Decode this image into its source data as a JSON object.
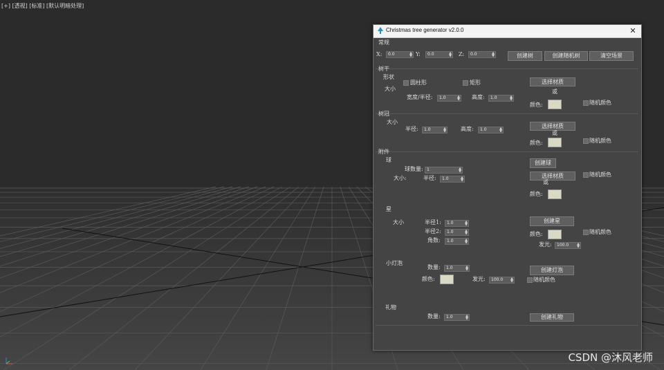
{
  "viewport": {
    "label": "[+] [透视] [标准] [默认明暗处理]",
    "watermark": "CSDN @沐风老师"
  },
  "dialog": {
    "title": "Christmas tree generator v2.0.0",
    "icon": "tree-app-icon",
    "close_icon": "✕"
  },
  "general": {
    "section": "常规",
    "x_label": "X:",
    "x_value": "0.0",
    "y_label": "Y:",
    "y_value": "0.0",
    "z_label": "Z:",
    "z_value": "0.0",
    "create_tree": "创建树",
    "create_random_tree": "创建随机树",
    "clear_scene": "清空场景"
  },
  "trunk": {
    "section": "树干",
    "shape_label": "形状",
    "cylinder": "圆柱形",
    "rectangle": "矩形",
    "size_label": "大小",
    "width_radius_label": "宽度/半径:",
    "width_radius_value": "1.0",
    "height_label": "高度:",
    "height_value": "1.0",
    "select_material": "选择材质",
    "or": "或",
    "color_label": "颜色:",
    "random_color": "随机颜色"
  },
  "crown": {
    "section": "树冠",
    "size_label": "大小",
    "radius_label": "半径:",
    "radius_value": "1.0",
    "height_label": "高度:",
    "height_value": "1.0",
    "select_material": "选择材质",
    "or": "或",
    "color_label": "颜色:",
    "random_color": "随机颜色"
  },
  "attachments": {
    "section": "附件",
    "ball": {
      "label": "球",
      "count_label": "球数量:",
      "count_value": "1",
      "size_label": "大小:",
      "radius_label": "半径:",
      "radius_value": "1.0",
      "create": "创建球",
      "select_material": "选择材质",
      "or": "或",
      "color_label": "颜色:",
      "random_color": "随机颜色"
    },
    "star": {
      "label": "星",
      "size_label": "大小",
      "radius1_label": "半径1:",
      "radius1_value": "1.0",
      "radius2_label": "半径2:",
      "radius2_value": "1.0",
      "corners_label": "角数:",
      "corners_value": "1.0",
      "create": "创建星",
      "color_label": "颜色:",
      "random_color": "随机颜色",
      "glow_label": "发光:",
      "glow_value": "100.0"
    },
    "bulb": {
      "label": "小灯泡",
      "count_label": "数量:",
      "count_value": "1.0",
      "color_label": "颜色:",
      "glow_label": "发光:",
      "glow_value": "100.0",
      "create": "创建灯泡",
      "random_color": "随机颜色"
    },
    "gift": {
      "label": "礼物",
      "count_label": "数量:",
      "count_value": "1.0",
      "create": "创建礼物"
    }
  },
  "colors": {
    "swatch": "#d9d9c6",
    "panel": "#444444",
    "viewport": "#2b2b2b"
  }
}
